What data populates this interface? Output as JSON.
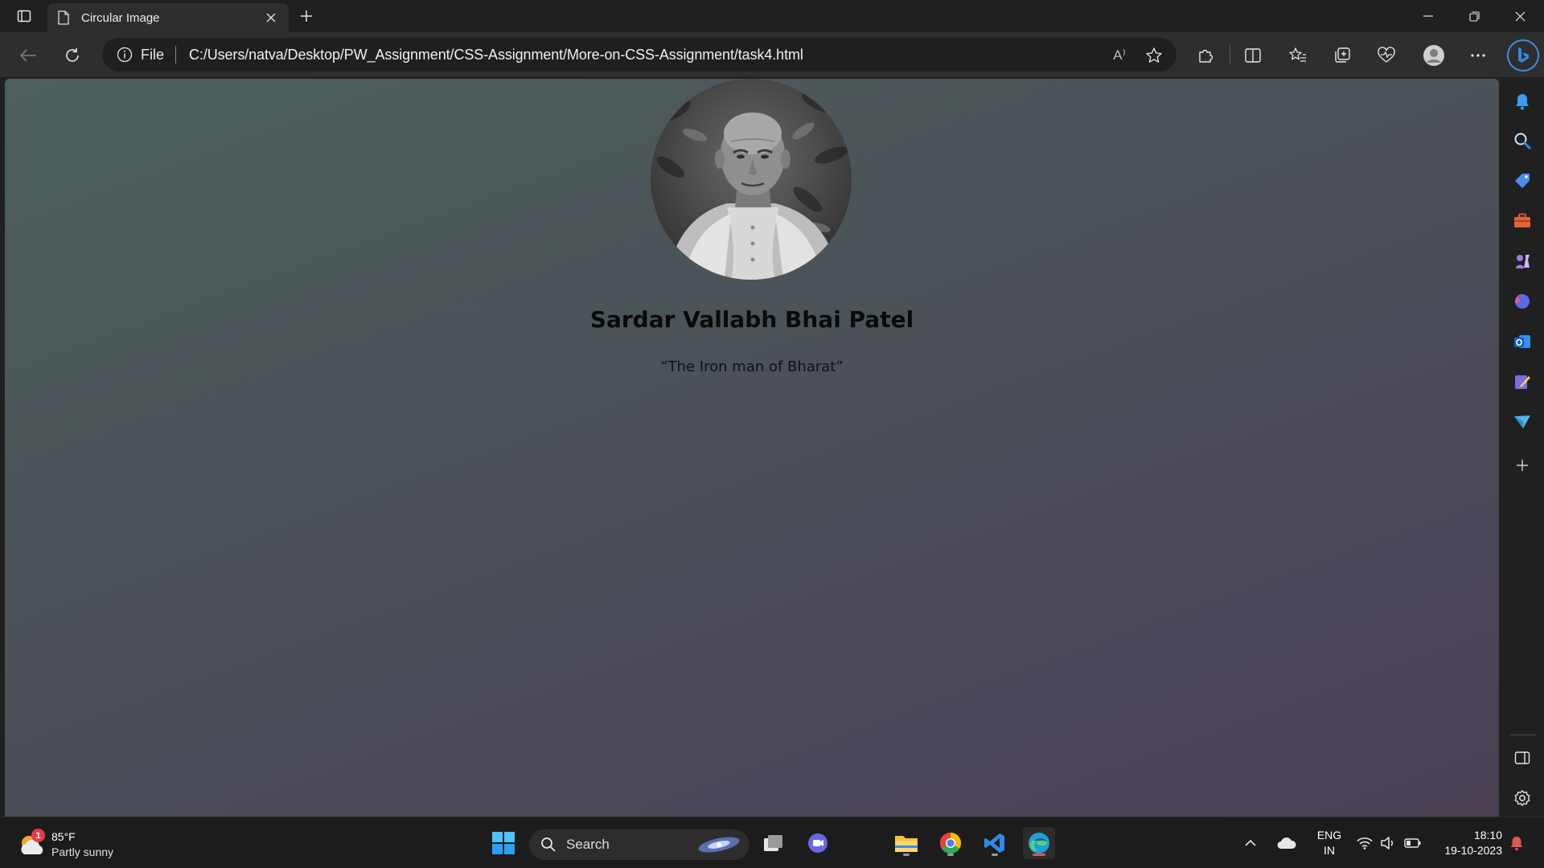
{
  "browser": {
    "tab_title": "Circular Image",
    "omnibox": {
      "scheme_label": "File",
      "url": "C:/Users/natva/Desktop/PW_Assignment/CSS-Assignment/More-on-CSS-Assignment/task4.html"
    },
    "read_aloud_label": "A⁾"
  },
  "page": {
    "name": "Sardar Vallabh Bhai Patel",
    "quote": "“The Iron man of Bharat”",
    "colors": {
      "gradient_start": "#4c5e5d",
      "gradient_end": "#4a3f52"
    }
  },
  "taskbar": {
    "weather": {
      "temperature": "85°F",
      "condition": "Partly sunny",
      "badge": "1"
    },
    "search_label": "Search",
    "language": {
      "line1": "ENG",
      "line2": "IN"
    },
    "clock": {
      "time": "18:10",
      "date": "19-10-2023"
    }
  }
}
